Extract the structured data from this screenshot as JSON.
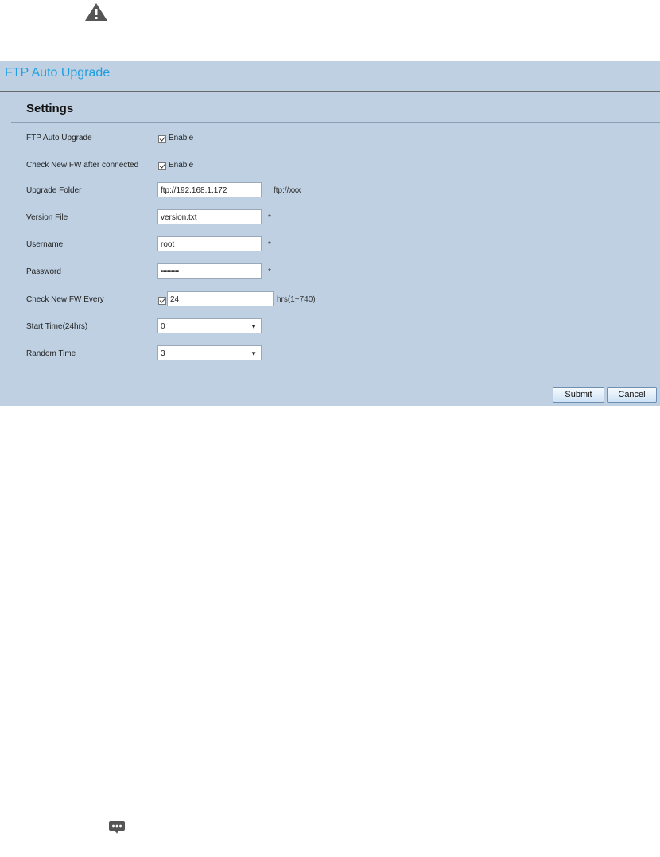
{
  "panel": {
    "title": "FTP Auto Upgrade"
  },
  "settings": {
    "title": "Settings",
    "ftp_auto_upgrade": {
      "label": "FTP Auto Upgrade",
      "checkbox_label": "Enable"
    },
    "check_new_fw_after_connected": {
      "label": "Check New FW after connected",
      "checkbox_label": "Enable"
    },
    "upgrade_folder": {
      "label": "Upgrade Folder",
      "value": "ftp://192.168.1.172",
      "hint": "ftp://xxx"
    },
    "version_file": {
      "label": "Version File",
      "value": "version.txt",
      "required": "*"
    },
    "username": {
      "label": "Username",
      "value": "root",
      "required": "*"
    },
    "password": {
      "label": "Password",
      "value": "•••••••••",
      "required": "*"
    },
    "check_new_fw_every": {
      "label": "Check New FW Every",
      "value": "24",
      "hint": "hrs(1~740)"
    },
    "start_time": {
      "label": "Start Time(24hrs)",
      "value": "0"
    },
    "random_time": {
      "label": "Random Time",
      "value": "3"
    }
  },
  "buttons": {
    "submit": "Submit",
    "cancel": "Cancel"
  },
  "icons": {
    "top": "warning-triangle-icon",
    "bottom": "chat-bubble-icon"
  }
}
